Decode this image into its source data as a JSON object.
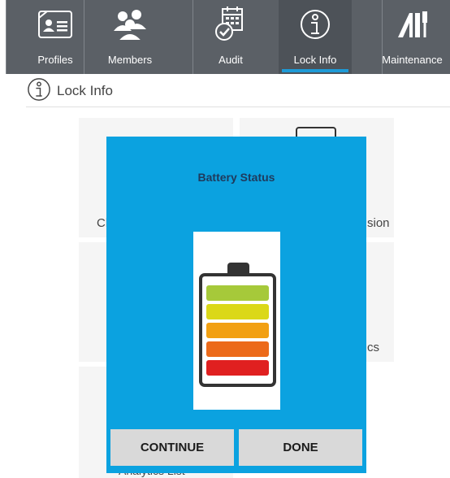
{
  "nav": {
    "tabs": [
      {
        "label": "Profiles",
        "icon": "profile-card-icon"
      },
      {
        "label": "Members",
        "icon": "members-icon"
      },
      {
        "label": "Audit",
        "icon": "audit-calendar-icon"
      },
      {
        "label": "Lock Info",
        "icon": "info-icon",
        "active": true
      },
      {
        "label": "Maintenance",
        "icon": "maintenance-icon"
      }
    ],
    "active_color": "#1e9ad6"
  },
  "page": {
    "title": "Lock Info"
  },
  "tiles": {
    "partial_left_1": "Ch",
    "partial_right_1": "sion",
    "partial_right_2": "cs",
    "analytics_list": "Analytics List"
  },
  "modal": {
    "title": "Battery Status",
    "battery_icon": "battery-level-icon",
    "battery_levels": [
      "#e02020",
      "#ec6a1a",
      "#f2a012",
      "#dbd818",
      "#a6c93a"
    ],
    "continue_label": "CONTINUE",
    "done_label": "DONE",
    "background": "#0ba2e0"
  }
}
